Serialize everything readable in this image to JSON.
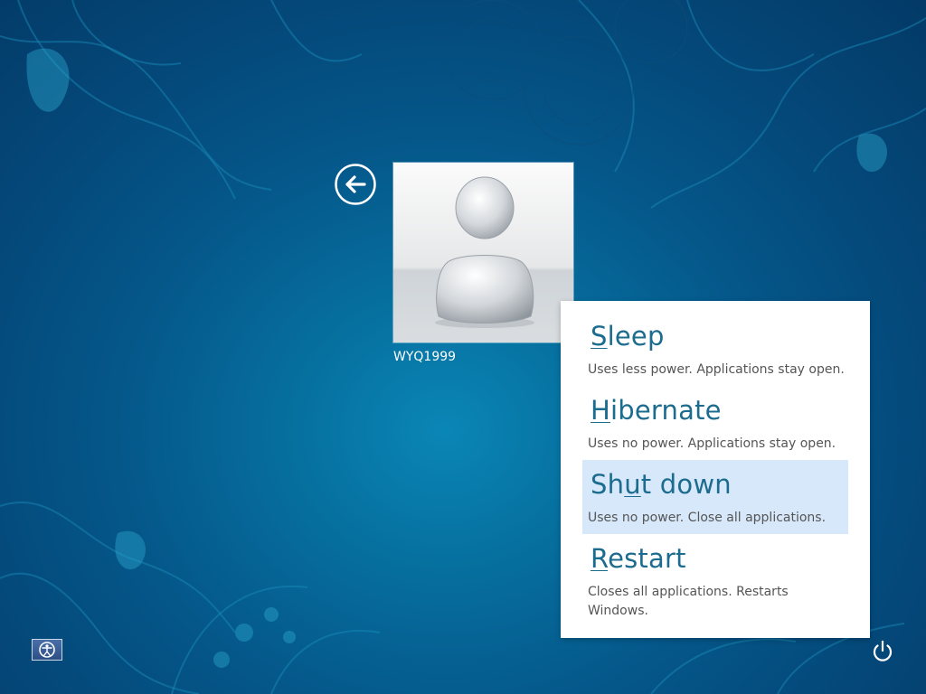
{
  "user": {
    "name": "WYQ1999"
  },
  "power_menu": {
    "items": [
      {
        "prefix": "",
        "hotkey": "S",
        "rest": "leep",
        "description": "Uses less power. Applications stay open."
      },
      {
        "prefix": "",
        "hotkey": "H",
        "rest": "ibernate",
        "description": "Uses no power. Applications stay open."
      },
      {
        "prefix": "Sh",
        "hotkey": "u",
        "rest": "t down",
        "description": "Uses no power. Close all applications."
      },
      {
        "prefix": "",
        "hotkey": "R",
        "rest": "estart",
        "description": "Closes all applications. Restarts Windows."
      }
    ],
    "selected_index": 2
  },
  "icons": {
    "back": "back-arrow-icon",
    "power": "power-icon",
    "ease_of_access": "ease-of-access-icon",
    "user_picture": "user-silhouette-icon"
  },
  "colors": {
    "background": "#05578a",
    "menu_title": "#1b6c8e",
    "menu_description": "#555555",
    "selection": "#d7e8fa"
  }
}
